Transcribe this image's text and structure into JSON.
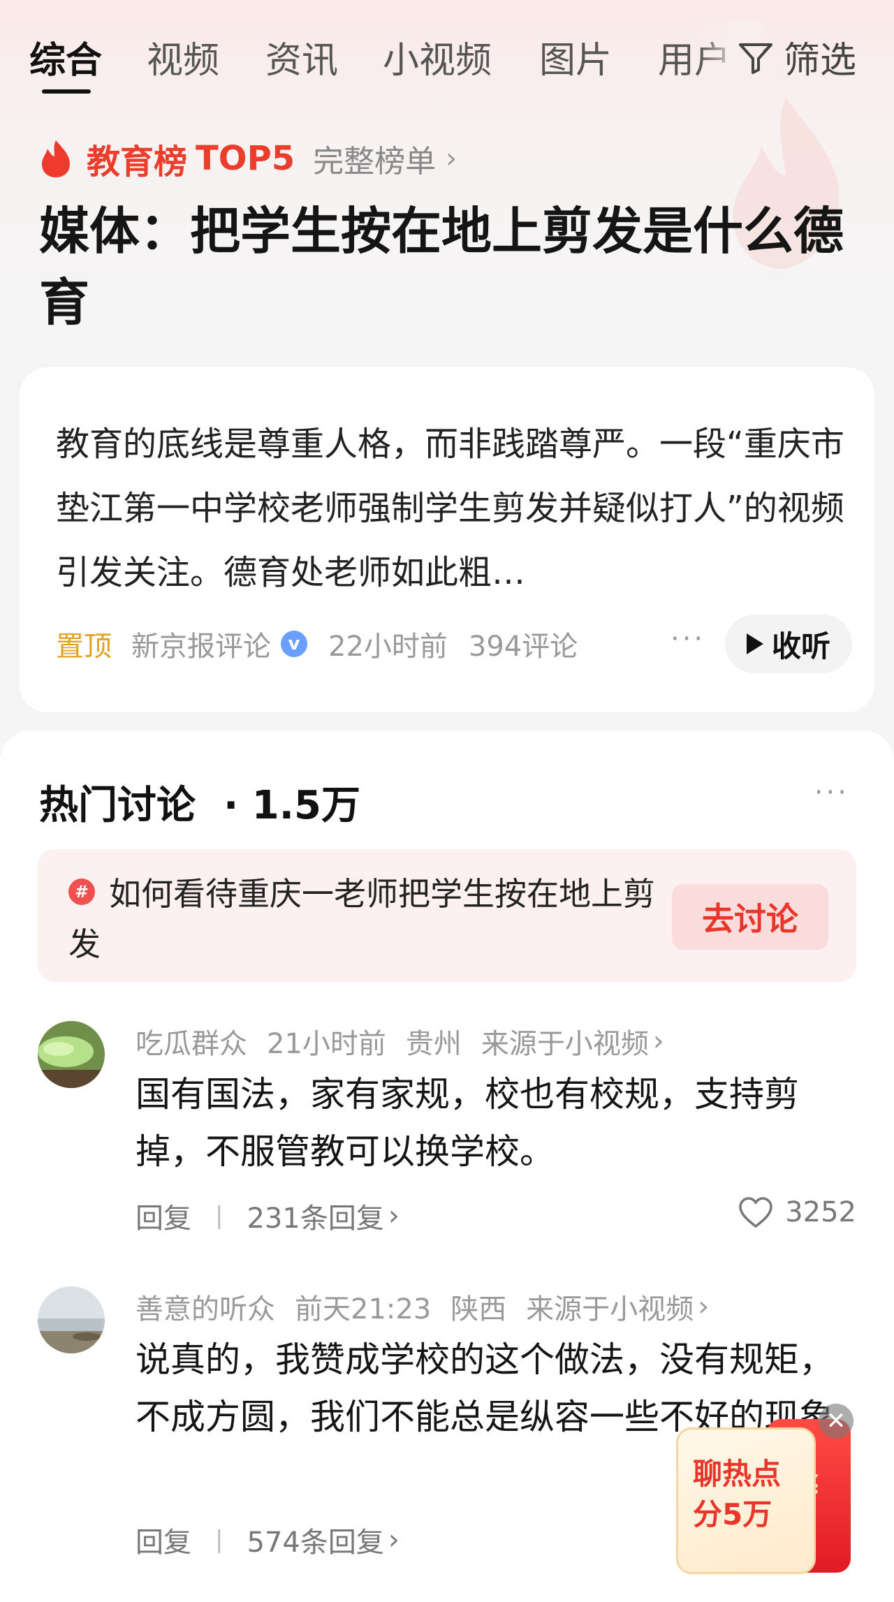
{
  "tabs": {
    "items": [
      "综合",
      "视频",
      "资讯",
      "小视频",
      "图片",
      "用户"
    ],
    "active_index": 0,
    "filter_label": "筛选"
  },
  "ranking": {
    "label": "教育榜",
    "top": "TOP5",
    "full_list": "完整榜单"
  },
  "headline": "媒体：把学生按在地上剪发是什么德育",
  "article": {
    "summary": "教育的底线是尊重人格，而非践踏尊严。一段“重庆市垫江第一中学校老师强制学生剪发并疑似打人”的视频引发关注。德育处老师如此粗…",
    "pinned": "置顶",
    "source": "新京报评论",
    "verified_mark": "v",
    "time": "22小时前",
    "comments": "394评论",
    "more": "···",
    "listen": "收听"
  },
  "discussion": {
    "title": "热门讨论",
    "count": "· 1.5万",
    "more": "···",
    "topic": {
      "hash": "#",
      "text": "如何看待重庆一老师把学生按在地上剪发",
      "button": "去讨论"
    },
    "comments": [
      {
        "user": "吃瓜群众",
        "time": "21小时前",
        "location": "贵州",
        "origin": "来源于小视频",
        "text": "国有国法，家有家规，校也有校规，支持剪掉，不服管教可以换学校。",
        "reply": "回复",
        "replies": "231条回复",
        "likes": "3252"
      },
      {
        "user": "善意的听众",
        "time": "前天21:23",
        "location": "陕西",
        "origin": "来源于小视频",
        "text": "说真的，我赞成学校的这个做法，没有规矩，不成方圆，我们不能总是纵容一些不好的现象",
        "reply": "回复",
        "replies": "574条回复",
        "likes": ""
      }
    ]
  },
  "promo": {
    "line1": "聊热点",
    "line2": "分5万",
    "yen": "¥",
    "close": "✕"
  },
  "colors": {
    "accent_red": "#ec3c2c",
    "pin_orange": "#e2a21f",
    "verified_blue": "#6a9eff"
  }
}
